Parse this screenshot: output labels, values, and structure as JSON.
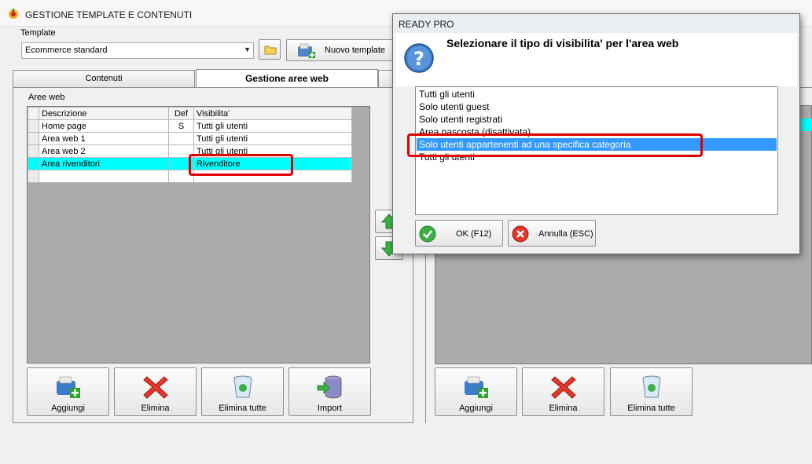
{
  "window": {
    "title": "GESTIONE TEMPLATE E CONTENUTI"
  },
  "template": {
    "label": "Template",
    "selected": "Ecommerce standard",
    "new_button": "Nuovo template"
  },
  "tabs": [
    {
      "label": "Contenuti"
    },
    {
      "label": "Gestione aree web"
    }
  ],
  "aree_web": {
    "label": "Aree web",
    "columns": [
      "Descrizione",
      "Def",
      "Visibilita'"
    ],
    "rows": [
      {
        "descrizione": "Home page",
        "def": "S",
        "visibilita": "Tutti gli utenti"
      },
      {
        "descrizione": "Area web 1",
        "def": "",
        "visibilita": "Tutti gli utenti"
      },
      {
        "descrizione": "Area web 2",
        "def": "",
        "visibilita": "Tutti gli utenti"
      },
      {
        "descrizione": "Area rivenditori",
        "def": "",
        "visibilita": "Rivenditore"
      }
    ]
  },
  "left_buttons": {
    "aggiungi": "Aggiungi",
    "elimina": "Elimina",
    "elimina_tutte": "Elimina tutte",
    "import": "Import"
  },
  "right_buttons": {
    "aggiungi": "Aggiungi",
    "elimina": "Elimina",
    "elimina_tutte": "Elimina tutte"
  },
  "dialog": {
    "title": "READY PRO",
    "prompt": "Selezionare il tipo di visibilita' per l'area web",
    "options": [
      "Tutti gli utenti",
      "Solo utenti guest",
      "Solo utenti registrati",
      "Area nascosta (disattivata)",
      "Solo utenti appartenenti ad una specifica categoria",
      "Tutti gli utenti"
    ],
    "selected_index": 4,
    "ok": "OK (F12)",
    "cancel": "Annulla (ESC)"
  },
  "colors": {
    "selection_row": "#00ffff",
    "list_selection": "#3399ff",
    "highlight_box": "#e00000"
  }
}
